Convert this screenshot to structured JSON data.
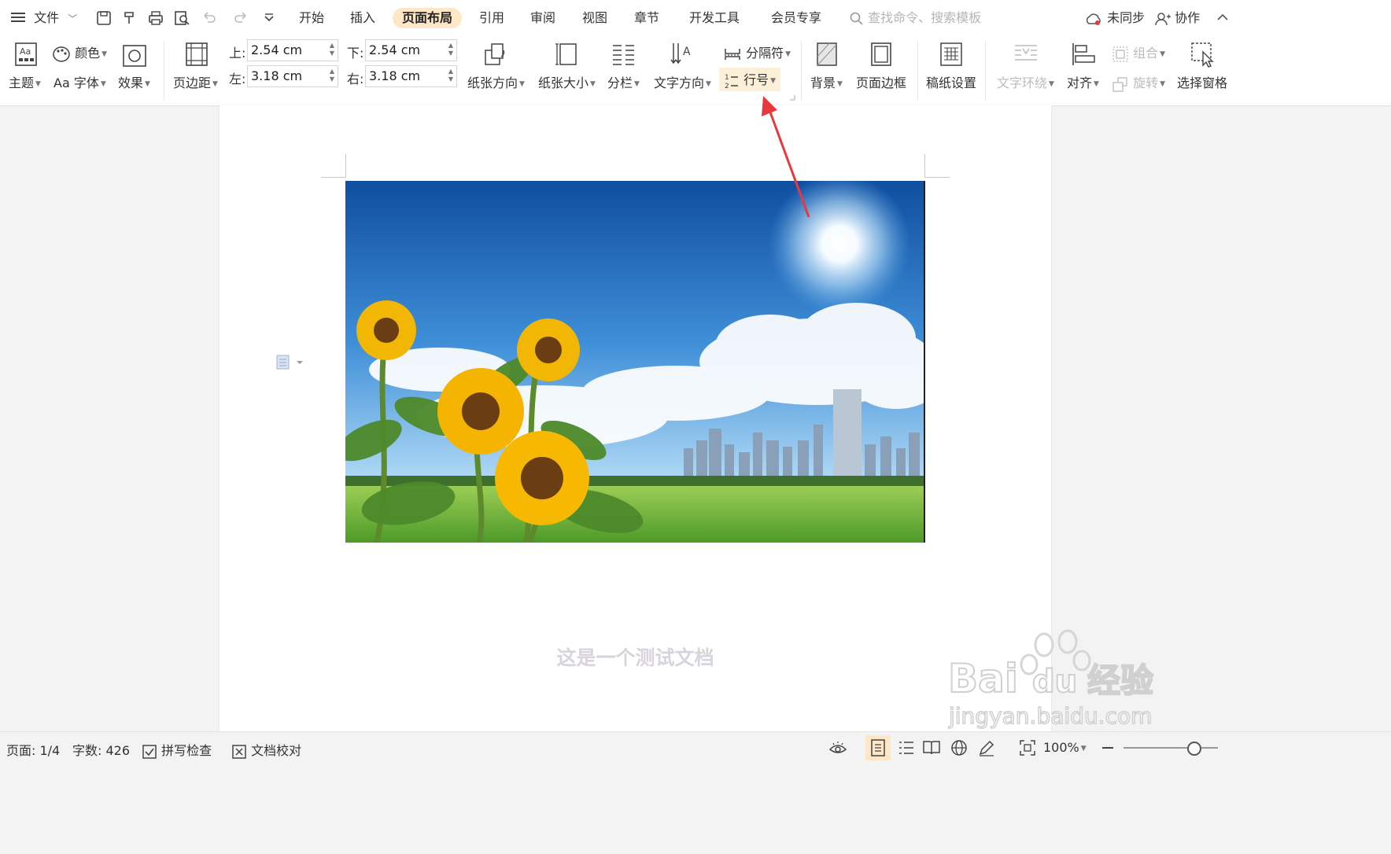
{
  "menubar": {
    "file_label": "文件",
    "tabs": [
      {
        "label": "开始"
      },
      {
        "label": "插入"
      },
      {
        "label": "页面布局"
      },
      {
        "label": "引用"
      },
      {
        "label": "审阅"
      },
      {
        "label": "视图"
      },
      {
        "label": "章节"
      },
      {
        "label": "开发工具"
      },
      {
        "label": "会员专享"
      }
    ],
    "active_tab": "页面布局",
    "search_placeholder": "查找命令、搜索模板",
    "sync_label": "未同步",
    "collab_label": "协作"
  },
  "ribbon": {
    "theme_label": "主题",
    "color_label": "颜色",
    "font_label": "Aa 字体",
    "effect_label": "效果",
    "margins_label": "页边距",
    "margin_top_label": "上:",
    "margin_top_value": "2.54 cm",
    "margin_bottom_label": "下:",
    "margin_bottom_value": "2.54 cm",
    "margin_left_label": "左:",
    "margin_left_value": "3.18 cm",
    "margin_right_label": "右:",
    "margin_right_value": "3.18 cm",
    "orientation_label": "纸张方向",
    "size_label": "纸张大小",
    "columns_label": "分栏",
    "text_direction_label": "文字方向",
    "breaks_label": "分隔符",
    "line_numbers_label": "行号",
    "background_label": "背景",
    "page_border_label": "页面边框",
    "manuscript_label": "稿纸设置",
    "wrap_text_label": "文字环绕",
    "align_label": "对齐",
    "group_label": "组合",
    "rotate_label": "旋转",
    "selection_pane_label": "选择窗格"
  },
  "document": {
    "body_text": "这是一个测试文档",
    "watermark": "Baidu经验 jingyan.baidu.com"
  },
  "statusbar": {
    "page": "页面: 1/4",
    "word_count": "字数: 426",
    "spell_check": "拼写检查",
    "doc_proof": "文档校对",
    "zoom": "100%"
  },
  "colors": {
    "active_tab_bg": "#fde7c7",
    "annotation_arrow": "#e8383d",
    "highlight_bg": "#fdf0d8"
  }
}
